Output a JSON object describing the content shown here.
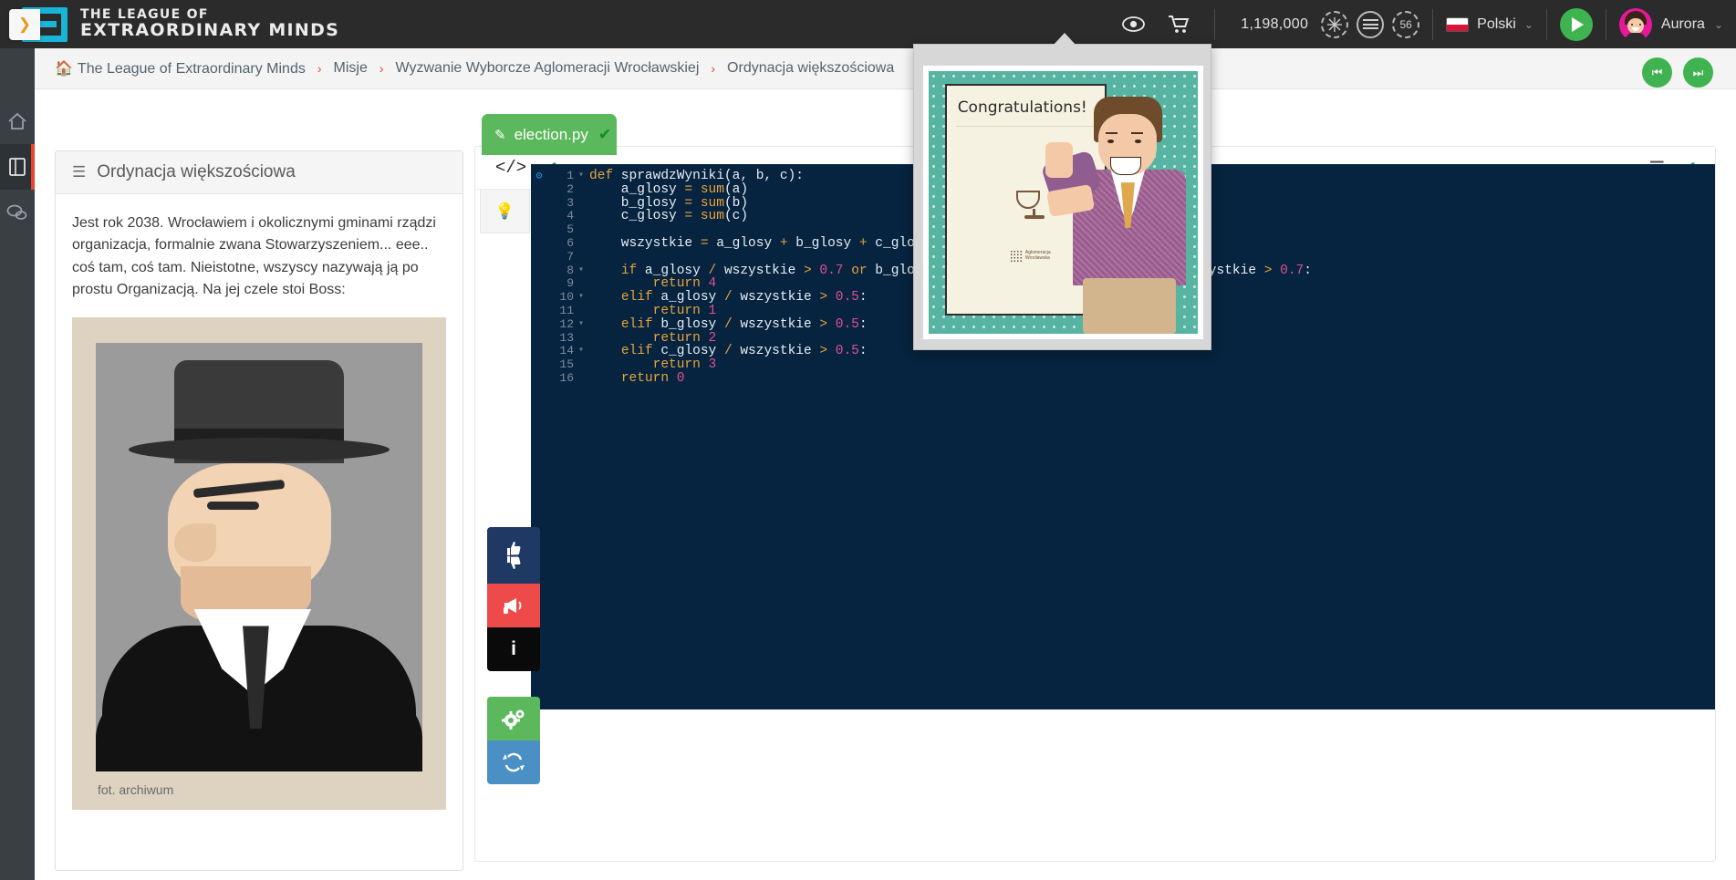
{
  "brand": {
    "line1": "THE LEAGUE OF",
    "line2": "EXTRAORDINARY MINDS",
    "logo_icon": "league-logo-icon"
  },
  "header": {
    "eye_icon": "eye-icon",
    "cart_icon": "shopping-cart-icon",
    "points": "1,198,000",
    "badges": [
      {
        "icon": "snowflake-badge-icon",
        "label": ""
      },
      {
        "icon": "lines-badge-icon",
        "label": ""
      },
      {
        "icon": "level-badge-icon",
        "label": "56"
      }
    ],
    "language": {
      "label": "Polski",
      "flag": "poland-flag-icon",
      "caret": "⌄"
    },
    "play_button": {
      "icon": "play-icon"
    },
    "user": {
      "name": "Aurora",
      "avatar_icon": "user-avatar-icon",
      "caret": "⌄"
    }
  },
  "sidebar": {
    "toggle_icon": "chevron-right-icon",
    "items": [
      {
        "icon": "home-icon",
        "name": "home",
        "active": false
      },
      {
        "icon": "notebook-icon",
        "name": "missions",
        "active": true
      },
      {
        "icon": "chat-bubbles-icon",
        "name": "messages",
        "active": false
      }
    ]
  },
  "breadcrumb": {
    "home_icon": "home-icon",
    "separator": "›",
    "items": [
      "The League of Extraordinary Minds",
      "Misje",
      "Wyzwanie Wyborcze Aglomeracji Wrocławskiej",
      "Ordynacja większościowa"
    ]
  },
  "nav_buttons": [
    {
      "name": "previous-step-button",
      "icon": "⏮"
    },
    {
      "name": "next-step-button",
      "icon": "⏭"
    }
  ],
  "left_panel": {
    "burger_icon": "hamburger-icon",
    "title": "Ordynacja większościowa",
    "story": "Jest rok 2038. Wrocławiem i okolicznymi gminami rządzi organizacja, formalnie zwana Stowarzyszeniem... eee.. coś tam, coś tam. Nieistotne, wszyscy nazywają ją po prostu Organizacją. Na jej czele stoi Boss:",
    "figure_caption": "fot. archiwum",
    "figure_icon": "boss-portrait-image"
  },
  "editor": {
    "toolbar": {
      "code_icon": "code-brackets-icon",
      "check_icon": "checkmark-icon",
      "list_icon": "list-icon",
      "right_check_icon": "checkmark-icon"
    },
    "tab": {
      "label": "election.py",
      "pencil_icon": "pencil-icon",
      "check_icon": "checkmark-icon"
    },
    "hint_icon": "lightbulb-icon",
    "gutter_icon": "gear-icon",
    "lines": [
      {
        "n": "1",
        "fold": "▾",
        "code": "def sprawdzWyniki(a, b, c):"
      },
      {
        "n": "2",
        "fold": "",
        "code": "    a_glosy = sum(a)"
      },
      {
        "n": "3",
        "fold": "",
        "code": "    b_glosy = sum(b)"
      },
      {
        "n": "4",
        "fold": "",
        "code": "    c_glosy = sum(c)"
      },
      {
        "n": "5",
        "fold": "",
        "code": ""
      },
      {
        "n": "6",
        "fold": "",
        "code": "    wszystkie = a_glosy + b_glosy + c_glosy"
      },
      {
        "n": "7",
        "fold": "",
        "code": ""
      },
      {
        "n": "8",
        "fold": "▾",
        "code": "    if a_glosy / wszystkie > 0.7 or b_glosy / wszystkie > 0.7 or c_glosy / wszystkie > 0.7:"
      },
      {
        "n": "9",
        "fold": "",
        "code": "        return 4"
      },
      {
        "n": "10",
        "fold": "▾",
        "code": "    elif a_glosy / wszystkie > 0.5:"
      },
      {
        "n": "11",
        "fold": "",
        "code": "        return 1"
      },
      {
        "n": "12",
        "fold": "▾",
        "code": "    elif b_glosy / wszystkie > 0.5:"
      },
      {
        "n": "13",
        "fold": "",
        "code": "        return 2"
      },
      {
        "n": "14",
        "fold": "▾",
        "code": "    elif c_glosy / wszystkie > 0.5:"
      },
      {
        "n": "15",
        "fold": "",
        "code": "        return 3"
      },
      {
        "n": "16",
        "fold": "",
        "code": "    return 0"
      }
    ]
  },
  "action_buttons": [
    {
      "name": "rate-button",
      "icon": "thumbs-up-down-icon",
      "color": "#1f3864"
    },
    {
      "name": "report-button",
      "icon": "megaphone-icon",
      "color": "#ef4a4a"
    },
    {
      "name": "info-button",
      "icon": "info-icon",
      "color": "#0a0a0a"
    },
    {
      "name": "run-button",
      "icon": "gears-run-icon",
      "color": "#5cb85c"
    },
    {
      "name": "reset-button",
      "icon": "refresh-icon",
      "color": "#4a90c4"
    }
  ],
  "popup": {
    "name": "certificate-preview-popup",
    "certificate_title": "Congratulations!",
    "certificate_icon": "certificate-image",
    "logo_text": "Aglomeracja Wrocławska"
  },
  "colors": {
    "brand_cyan": "#18b5d8",
    "accent_red": "#e8452c",
    "green": "#5cb85c",
    "code_bg": "#06233f",
    "topbar_bg": "#2b2b2b"
  }
}
